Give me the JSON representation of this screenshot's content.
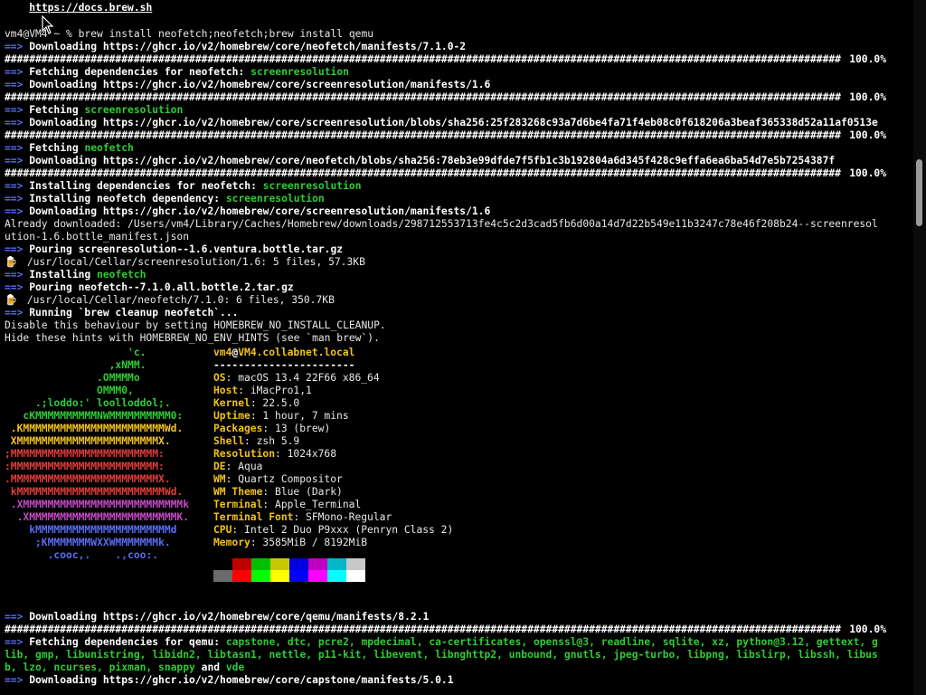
{
  "lines_top": [
    {
      "type": "link",
      "indent": "    ",
      "text": "https://docs.brew.sh"
    },
    {
      "type": "blank"
    },
    {
      "type": "prompt",
      "text": "vm4@VM4 ~ % brew install neofetch;neofetch;brew install qemu"
    },
    {
      "type": "arrow",
      "text": "Downloading https://ghcr.io/v2/homebrew/core/neofetch/manifests/7.1.0-2"
    },
    {
      "type": "progress"
    },
    {
      "type": "arrow",
      "text": "Fetching dependencies for neofetch: ",
      "green": "screenresolution"
    },
    {
      "type": "arrow",
      "text": "Downloading https://ghcr.io/v2/homebrew/core/screenresolution/manifests/1.6"
    },
    {
      "type": "progress"
    },
    {
      "type": "arrow",
      "text": "Fetching ",
      "green": "screenresolution"
    },
    {
      "type": "arrow",
      "text": "Downloading https://ghcr.io/v2/homebrew/core/screenresolution/blobs/sha256:25f283268c93a7d6be4fa71f4eb08c0f618206a3beaf365338d52a11af0513e"
    },
    {
      "type": "progress"
    },
    {
      "type": "arrow",
      "text": "Fetching ",
      "green": "neofetch"
    },
    {
      "type": "arrow",
      "text": "Downloading https://ghcr.io/v2/homebrew/core/neofetch/blobs/sha256:78eb3e99dfde7f5fb1c3b192804a6d345f428c9effa6ea6ba54d7e5b7254387f"
    },
    {
      "type": "progress"
    },
    {
      "type": "arrow",
      "text": "Installing dependencies for neofetch: ",
      "green": "screenresolution"
    },
    {
      "type": "arrow",
      "text": "Installing neofetch dependency: ",
      "green": "screenresolution"
    },
    {
      "type": "arrow",
      "text": "Downloading https://ghcr.io/v2/homebrew/core/screenresolution/manifests/1.6"
    },
    {
      "type": "plain",
      "text": "Already downloaded: /Users/vm4/Library/Caches/Homebrew/downloads/298712553713fe4c5c2d3cad5fb6d00a14d7d22b549e11b3247c78e46f208b24--screenresol"
    },
    {
      "type": "plain",
      "text": "ution-1.6.bottle_manifest.json"
    },
    {
      "type": "arrow",
      "text": "Pouring screenresolution--1.6.ventura.bottle.tar.gz"
    },
    {
      "type": "beer",
      "text": "/usr/local/Cellar/screenresolution/1.6: 5 files, 57.3KB"
    },
    {
      "type": "arrow",
      "text": "Installing ",
      "green": "neofetch"
    },
    {
      "type": "arrow",
      "text": "Pouring neofetch--7.1.0.all.bottle.2.tar.gz"
    },
    {
      "type": "beer",
      "text": "/usr/local/Cellar/neofetch/7.1.0: 6 files, 350.7KB"
    },
    {
      "type": "arrow",
      "text": "Running `brew cleanup neofetch`..."
    },
    {
      "type": "plain",
      "text": "Disable this behaviour by setting HOMEBREW_NO_INSTALL_CLEANUP."
    },
    {
      "type": "plain",
      "text": "Hide these hints with HOMEBREW_NO_ENV_HINTS (see `man brew`)."
    }
  ],
  "arrow_symbol": "==>",
  "beer_symbol": "🍺",
  "progress_text": "######################################################################################################################################## ",
  "progress_pct": "100.0%",
  "neofetch": {
    "logo": [
      {
        "text": "                    'c.",
        "color": "#2fcb35"
      },
      {
        "text": "                 ,xNMM.",
        "color": "#2fcb35"
      },
      {
        "text": "               .OMMMMo",
        "color": "#2fcb35"
      },
      {
        "text": "               OMMM0,",
        "color": "#2fcb35"
      },
      {
        "text": "     .;loddo:' loolloddol;.",
        "color": "#2fcb35"
      },
      {
        "text": "   cKMMMMMMMMMMNWMMMMMMMMMM0:",
        "color": "#2fcb35"
      },
      {
        "text": " .KMMMMMMMMMMMMMMMMMMMMMMMWd.",
        "color": "#f0c21a"
      },
      {
        "text": " XMMMMMMMMMMMMMMMMMMMMMMMX.",
        "color": "#f0c21a"
      },
      {
        "text": ";MMMMMMMMMMMMMMMMMMMMMMMM:",
        "color": "#e03c3c"
      },
      {
        "text": ":MMMMMMMMMMMMMMMMMMMMMMMM:",
        "color": "#e03c3c"
      },
      {
        "text": ".MMMMMMMMMMMMMMMMMMMMMMMMX.",
        "color": "#e03c3c"
      },
      {
        "text": " kMMMMMMMMMMMMMMMMMMMMMMMMWd.",
        "color": "#e03c3c"
      },
      {
        "text": " .XMMMMMMMMMMMMMMMMMMMMMMMMMMk",
        "color": "#c44ac4"
      },
      {
        "text": "  .XMMMMMMMMMMMMMMMMMMMMMMMMK.",
        "color": "#c44ac4"
      },
      {
        "text": "    kMMMMMMMMMMMMMMMMMMMMMMd",
        "color": "#5a6cf0"
      },
      {
        "text": "     ;KMMMMMMMWXXWMMMMMMMk.",
        "color": "#5a6cf0"
      },
      {
        "text": "       .cooc,.    .,coo:.",
        "color": "#5a6cf0"
      }
    ],
    "user": "vm4",
    "at": "@",
    "host": "VM4.collabnet.local",
    "separator": "-----------------------",
    "fields": [
      {
        "key": "OS",
        "value": "macOS 13.4 22F66 x86_64"
      },
      {
        "key": "Host",
        "value": "iMacPro1,1"
      },
      {
        "key": "Kernel",
        "value": "22.5.0"
      },
      {
        "key": "Uptime",
        "value": "1 hour, 7 mins"
      },
      {
        "key": "Packages",
        "value": "13 (brew)"
      },
      {
        "key": "Shell",
        "value": "zsh 5.9"
      },
      {
        "key": "Resolution",
        "value": "1024x768"
      },
      {
        "key": "DE",
        "value": "Aqua"
      },
      {
        "key": "WM",
        "value": "Quartz Compositor"
      },
      {
        "key": "WM Theme",
        "value": "Blue (Dark)"
      },
      {
        "key": "Terminal",
        "value": "Apple_Terminal"
      },
      {
        "key": "Terminal Font",
        "value": "SFMono-Regular"
      },
      {
        "key": "CPU",
        "value": "Intel 2 Duo P9xxx (Penryn Class 2)"
      },
      {
        "key": "Memory",
        "value": "3585MiB / 8192MiB"
      }
    ],
    "colors_dark": [
      "#000000",
      "#c00000",
      "#00c000",
      "#c8c800",
      "#0000e0",
      "#c000c0",
      "#00b8c8",
      "#c8c8c8"
    ],
    "colors_bright": [
      "#6a6a6a",
      "#ff0000",
      "#00ff00",
      "#ffff00",
      "#0000ff",
      "#ff00ff",
      "#00ffff",
      "#ffffff"
    ]
  },
  "lines_bottom": [
    {
      "type": "blank"
    },
    {
      "type": "blank"
    },
    {
      "type": "arrow",
      "text": "Downloading https://ghcr.io/v2/homebrew/core/qemu/manifests/8.2.1"
    },
    {
      "type": "progress"
    },
    {
      "type": "arrow",
      "text": "Fetching dependencies for qemu: ",
      "green": "capstone, dtc, pcre2, mpdecimal, ca-certificates, openssl@3, readline, sqlite, xz, python@3.12, gettext, g"
    },
    {
      "type": "greenline",
      "green": "lib, gmp, libunistring, libidn2, libtasn1, nettle, p11-kit, libevent, libnghttp2, unbound, gnutls, jpeg-turbo, libpng, libslirp, libssh, libus"
    },
    {
      "type": "greenline",
      "green": "b, lzo, ncurses, pixman, snappy",
      "plain_bold": " and ",
      "green2": "vde"
    },
    {
      "type": "arrow",
      "text": "Downloading https://ghcr.io/v2/homebrew/core/capstone/manifests/5.0.1"
    }
  ]
}
